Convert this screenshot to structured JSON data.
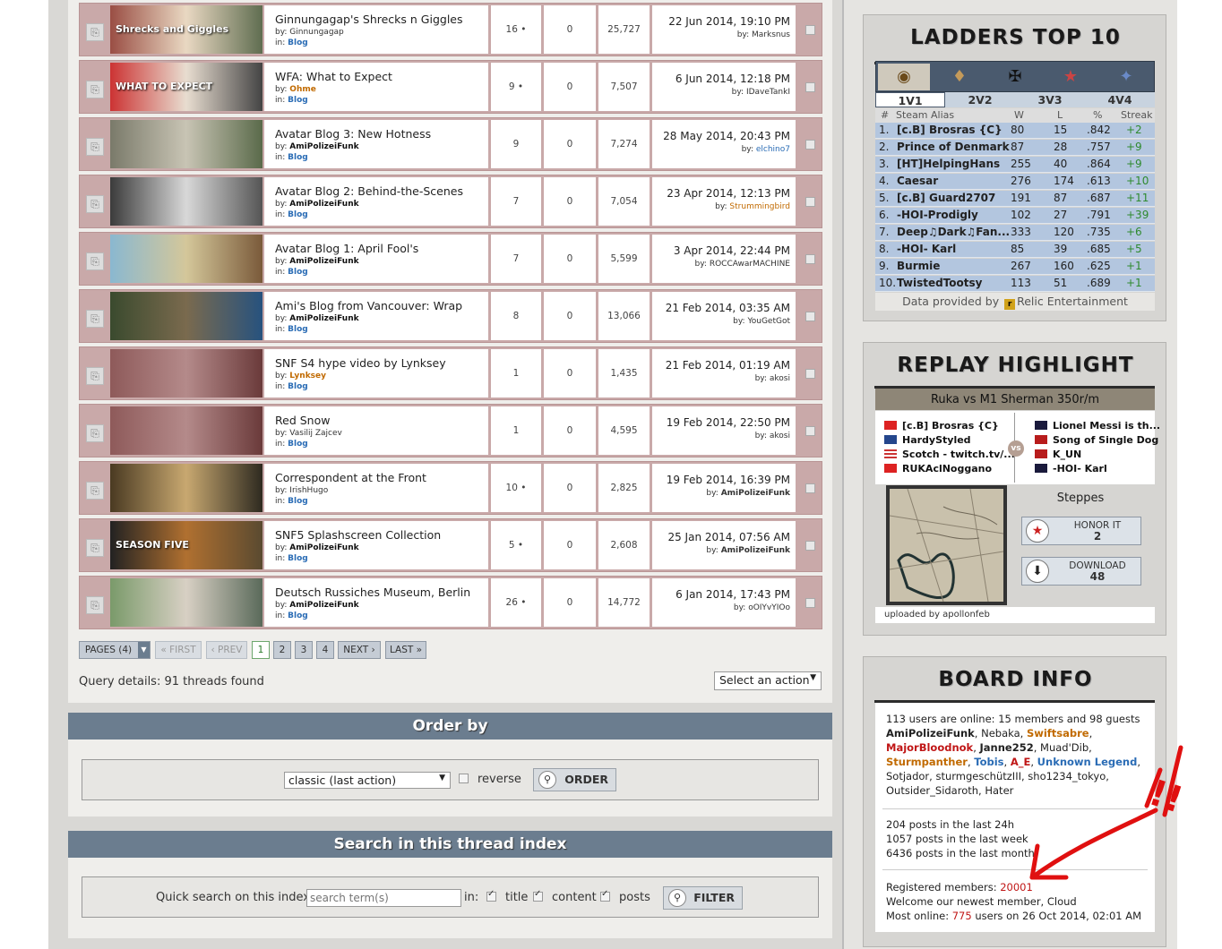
{
  "threads": [
    {
      "title": "Ginnungagap's Shrecks n Giggles",
      "by_label": "by:",
      "author": "Ginnungagap",
      "author_style": "plain",
      "in_label": "in:",
      "forum": "Blog",
      "replies": "16",
      "hot": true,
      "zero": "0",
      "views": "25,727",
      "last_date": "22 Jun 2014, 19:10 PM",
      "last_by": "Marksnus",
      "last_by_style": "plain"
    },
    {
      "title": "WFA: What to Expect",
      "by_label": "by:",
      "author": "Ohme",
      "author_style": "orange",
      "in_label": "in:",
      "forum": "Blog",
      "replies": "9",
      "hot": true,
      "zero": "0",
      "views": "7,507",
      "last_date": "6 Jun 2014, 12:18 PM",
      "last_by": "IDaveTankI",
      "last_by_style": "plain"
    },
    {
      "title": "Avatar Blog 3: New Hotness",
      "by_label": "by:",
      "author": "AmiPolizeiFunk",
      "author_style": "bold",
      "in_label": "in:",
      "forum": "Blog",
      "replies": "9",
      "hot": false,
      "zero": "0",
      "views": "7,274",
      "last_date": "28 May 2014, 20:43 PM",
      "last_by": "elchino7",
      "last_by_style": "blue"
    },
    {
      "title": "Avatar Blog 2: Behind-the-Scenes",
      "by_label": "by:",
      "author": "AmiPolizeiFunk",
      "author_style": "bold",
      "in_label": "in:",
      "forum": "Blog",
      "replies": "7",
      "hot": false,
      "zero": "0",
      "views": "7,054",
      "last_date": "23 Apr 2014, 12:13 PM",
      "last_by": "Strummingbird",
      "last_by_style": "orange"
    },
    {
      "title": "Avatar Blog 1: April Fool's",
      "by_label": "by:",
      "author": "AmiPolizeiFunk",
      "author_style": "bold",
      "in_label": "in:",
      "forum": "Blog",
      "replies": "7",
      "hot": false,
      "zero": "0",
      "views": "5,599",
      "last_date": "3 Apr 2014, 22:44 PM",
      "last_by": "ROCCAwarMACHINE",
      "last_by_style": "plain"
    },
    {
      "title": "Ami's Blog from Vancouver: Wrap",
      "by_label": "by:",
      "author": "AmiPolizeiFunk",
      "author_style": "bold",
      "in_label": "in:",
      "forum": "Blog",
      "replies": "8",
      "hot": false,
      "zero": "0",
      "views": "13,066",
      "last_date": "21 Feb 2014, 03:35 AM",
      "last_by": "YouGetGot",
      "last_by_style": "plain"
    },
    {
      "title": "SNF S4 hype video by Lynksey",
      "by_label": "by:",
      "author": "Lynksey",
      "author_style": "orange",
      "in_label": "in:",
      "forum": "Blog",
      "replies": "1",
      "hot": false,
      "zero": "0",
      "views": "1,435",
      "last_date": "21 Feb 2014, 01:19 AM",
      "last_by": "akosi",
      "last_by_style": "plain"
    },
    {
      "title": "Red Snow",
      "by_label": "by:",
      "author": "Vasilij Zajcev",
      "author_style": "plain",
      "in_label": "in:",
      "forum": "Blog",
      "replies": "1",
      "hot": false,
      "zero": "0",
      "views": "4,595",
      "last_date": "19 Feb 2014, 22:50 PM",
      "last_by": "akosi",
      "last_by_style": "plain"
    },
    {
      "title": "Correspondent at the Front",
      "by_label": "by:",
      "author": "IrishHugo",
      "author_style": "plain",
      "in_label": "in:",
      "forum": "Blog",
      "replies": "10",
      "hot": true,
      "zero": "0",
      "views": "2,825",
      "last_date": "19 Feb 2014, 16:39 PM",
      "last_by": "AmiPolizeiFunk",
      "last_by_style": "bold"
    },
    {
      "title": "SNF5 Splashscreen Collection",
      "by_label": "by:",
      "author": "AmiPolizeiFunk",
      "author_style": "bold",
      "in_label": "in:",
      "forum": "Blog",
      "replies": "5",
      "hot": true,
      "zero": "0",
      "views": "2,608",
      "last_date": "25 Jan 2014, 07:56 AM",
      "last_by": "AmiPolizeiFunk",
      "last_by_style": "bold"
    },
    {
      "title": "Deutsch Russiches Museum, Berlin",
      "by_label": "by:",
      "author": "AmiPolizeiFunk",
      "author_style": "bold",
      "in_label": "in:",
      "forum": "Blog",
      "replies": "26",
      "hot": true,
      "zero": "0",
      "views": "14,772",
      "last_date": "6 Jan 2014, 17:43 PM",
      "last_by": "oOIYvYIOo",
      "last_by_style": "plain"
    }
  ],
  "thumb_texts": [
    "Shrecks and Giggles",
    "WHAT TO EXPECT",
    "",
    "",
    "",
    "",
    "",
    "",
    "",
    "SEASON FIVE",
    ""
  ],
  "pagination": {
    "pages": "PAGES (4)",
    "first": "« FIRST",
    "prev": "‹ PREV",
    "pages_list": [
      "1",
      "2",
      "3",
      "4"
    ],
    "current": "1",
    "next": "NEXT ›",
    "last": "LAST »"
  },
  "query": "Query details: 91 threads found",
  "select_action": "Select an action",
  "order": {
    "title": "Order by",
    "select": "classic (last action)",
    "reverse": "reverse",
    "button": "ORDER"
  },
  "search": {
    "title": "Search in this thread index",
    "label": "Quick search on this index",
    "placeholder": "search term(s)",
    "in": "in:",
    "title_opt": "title",
    "content_opt": "content",
    "posts_opt": "posts",
    "button": "FILTER"
  },
  "ladders": {
    "title": "LADDERS TOP 10",
    "modes": [
      "1V1",
      "2V2",
      "3V3",
      "4V4"
    ],
    "selected_mode": "1V1",
    "headers": {
      "rank": "#",
      "alias": "Steam Alias",
      "w": "W",
      "l": "L",
      "pct": "%",
      "streak": "Streak"
    },
    "rows": [
      {
        "rank": "1.",
        "name": "[c.B] Brosras {C}",
        "w": "80",
        "l": "15",
        "pct": ".842",
        "streak": "+2"
      },
      {
        "rank": "2.",
        "name": "Prince of Denmark",
        "w": "87",
        "l": "28",
        "pct": ".757",
        "streak": "+9"
      },
      {
        "rank": "3.",
        "name": "[HT]HelpingHans",
        "w": "255",
        "l": "40",
        "pct": ".864",
        "streak": "+9"
      },
      {
        "rank": "4.",
        "name": "Caesar",
        "w": "276",
        "l": "174",
        "pct": ".613",
        "streak": "+10"
      },
      {
        "rank": "5.",
        "name": "[c.B] Guard2707",
        "w": "191",
        "l": "87",
        "pct": ".687",
        "streak": "+11"
      },
      {
        "rank": "6.",
        "name": "-HOI-Prodigly",
        "w": "102",
        "l": "27",
        "pct": ".791",
        "streak": "+39"
      },
      {
        "rank": "7.",
        "name": "Deep♫Dark♫Fan...",
        "w": "333",
        "l": "120",
        "pct": ".735",
        "streak": "+6"
      },
      {
        "rank": "8.",
        "name": "-HOI- Karl",
        "w": "85",
        "l": "39",
        "pct": ".685",
        "streak": "+5"
      },
      {
        "rank": "9.",
        "name": "Burmie",
        "w": "267",
        "l": "160",
        "pct": ".625",
        "streak": "+1"
      },
      {
        "rank": "10.",
        "name": "TwistedTootsy",
        "w": "113",
        "l": "51",
        "pct": ".689",
        "streak": "+1"
      }
    ],
    "footer_pre": "Data provided by",
    "footer_post": "Relic Entertainment"
  },
  "replay": {
    "title": "REPLAY HIGHLIGHT",
    "match": "Ruka vs M1 Sherman 350r/m",
    "left_team": [
      "[c.B] Brosras {C}",
      "HardyStyled",
      "Scotch - twitch.tv/...",
      "RUKAclNoggano"
    ],
    "right_team": [
      "Lionel Messi is th...",
      "Song of Single Dog",
      "K_UN",
      "-HOI- Karl"
    ],
    "vs": "vs",
    "map": "Steppes",
    "honor_label": "HONOR IT",
    "honor_count": "2",
    "download_label": "DOWNLOAD",
    "download_count": "48",
    "uploaded": "uploaded by apollonfeb"
  },
  "board": {
    "title": "BOARD INFO",
    "online_intro": "113 users are online: 15 members and 98 guests",
    "members": [
      {
        "name": "AmiPolizeiFunk",
        "style": "b"
      },
      {
        "name": "Nebaka",
        "style": ""
      },
      {
        "name": "Swiftsabre",
        "style": "orange b"
      },
      {
        "name": "MajorBloodnok",
        "style": "red b"
      },
      {
        "name": "Janne252",
        "style": "b"
      },
      {
        "name": "Muad'Dib",
        "style": ""
      },
      {
        "name": "Sturmpanther",
        "style": "orange b"
      },
      {
        "name": "Tobis",
        "style": "blue b"
      },
      {
        "name": "A_E",
        "style": "red b"
      },
      {
        "name": "Unknown Legend",
        "style": "blue b"
      },
      {
        "name": "Sotjador",
        "style": ""
      },
      {
        "name": "sturmgeschützIII",
        "style": ""
      },
      {
        "name": "sho1234_tokyo",
        "style": ""
      },
      {
        "name": "Outsider_Sidaroth",
        "style": ""
      },
      {
        "name": "Hater",
        "style": ""
      }
    ],
    "posts_24h": "204 posts in the last 24h",
    "posts_week": "1057 posts in the last week",
    "posts_month": "6436 posts in the last month",
    "registered_label": "Registered members:",
    "registered_count": "20001",
    "newest": "Welcome our newest member, Cloud",
    "most_pre": "Most online:",
    "most_count": "775",
    "most_post": "users on 26 Oct 2014, 02:01 AM"
  },
  "annotation": "!!",
  "colors": {
    "ladder_row": "#b3c6df",
    "bar": "#6b7d8f",
    "red": "#c01616",
    "orange": "#c16a00",
    "blue": "#2a6cb5",
    "arrow": "#e01010"
  }
}
